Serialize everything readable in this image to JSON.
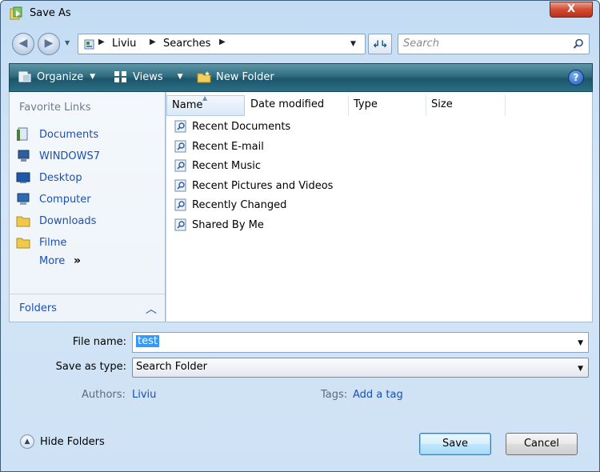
{
  "window": {
    "title": "Save As",
    "close_label": "X"
  },
  "address": {
    "crumbs": [
      "Liviu",
      "Searches"
    ],
    "separator": "▶",
    "dropdown_glyph": "▼",
    "refresh_glyph": "↲↳"
  },
  "search": {
    "placeholder": "Search"
  },
  "toolbar": {
    "organize_label": "Organize",
    "views_label": "Views",
    "new_folder_label": "New Folder",
    "help_glyph": "?"
  },
  "favorites": {
    "title": "Favorite Links",
    "items": [
      {
        "label": "Documents",
        "icon": "documents-icon"
      },
      {
        "label": "WINDOWS7",
        "icon": "computer-icon"
      },
      {
        "label": "Desktop",
        "icon": "desktop-icon"
      },
      {
        "label": "Computer",
        "icon": "computer-icon"
      },
      {
        "label": "Downloads",
        "icon": "folder-icon"
      },
      {
        "label": "Filme",
        "icon": "folder-icon"
      }
    ],
    "more_label": "More",
    "more_glyph": "»"
  },
  "folders": {
    "label": "Folders",
    "chevron": "︿"
  },
  "file_list": {
    "columns": [
      "Name",
      "Date modified",
      "Type",
      "Size"
    ],
    "items": [
      "Recent Documents",
      "Recent E-mail",
      "Recent Music",
      "Recent Pictures and Videos",
      "Recently Changed",
      "Shared By Me"
    ]
  },
  "form": {
    "file_name_label": "File name:",
    "file_name_value": "test",
    "save_type_label": "Save as type:",
    "save_type_value": "Search Folder",
    "authors_label": "Authors:",
    "authors_value": "Liviu",
    "tags_label": "Tags:",
    "tags_value": "Add a tag"
  },
  "footer": {
    "hide_folders_label": "Hide Folders",
    "save_label": "Save",
    "cancel_label": "Cancel"
  },
  "colors": {
    "toolbar": "#2f6c80",
    "link": "#1a4fb5",
    "selection": "#3399ff",
    "close": "#d24b32"
  }
}
